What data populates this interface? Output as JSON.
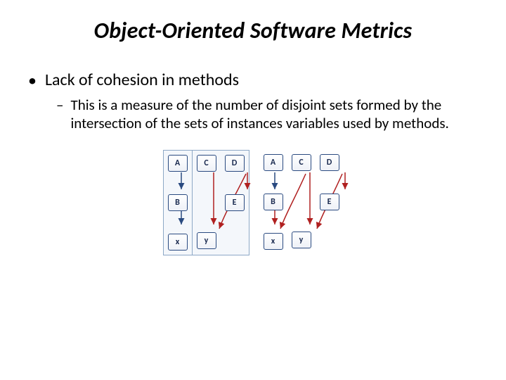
{
  "title": "Object-Oriented Software Metrics",
  "bullet_main": "Lack of cohesion in methods",
  "bullet_sub": "This is a measure of the number of disjoint sets formed by the intersection of the sets of instances variables used by methods.",
  "nodes": {
    "A": "A",
    "B": "B",
    "C": "C",
    "D": "D",
    "E": "E",
    "x": "x",
    "y": "y"
  }
}
